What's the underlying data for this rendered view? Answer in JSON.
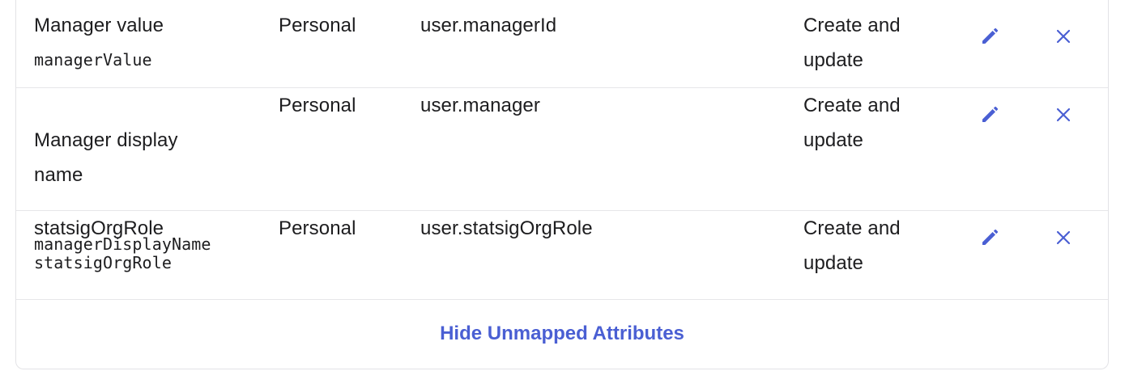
{
  "rows": [
    {
      "label": "Manager value",
      "key": "managerValue",
      "type": "Personal",
      "expression": "user.managerId",
      "apply_on": "Create and\nupdate"
    },
    {
      "label": "Manager display\nname",
      "key": "managerDisplayName",
      "type": "Personal",
      "expression": "user.manager",
      "apply_on": "Create and\nupdate"
    },
    {
      "label": "statsigOrgRole",
      "key": "statsigOrgRole",
      "type": "Personal",
      "expression": "user.statsigOrgRole",
      "apply_on": "Create and\nupdate"
    }
  ],
  "footer": {
    "toggle_label": "Hide Unmapped Attributes"
  },
  "icons": {
    "edit": "pencil-icon",
    "remove": "close-icon"
  },
  "colors": {
    "accent": "#4a5fd3",
    "border": "#e3e3e6",
    "text": "#1d1d1f"
  }
}
